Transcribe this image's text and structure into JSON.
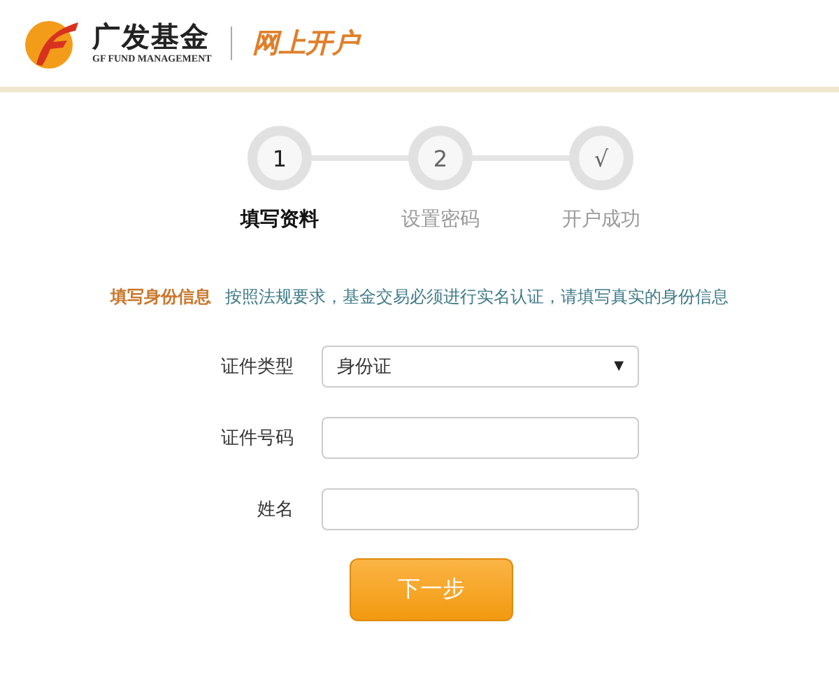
{
  "header": {
    "brand": "广发基金",
    "brand_sub": "GF FUND MANAGEMENT",
    "section": "网上开户"
  },
  "steps": [
    {
      "mark": "1",
      "label": "填写资料",
      "selected": true
    },
    {
      "mark": "2",
      "label": "设置密码",
      "selected": false
    },
    {
      "mark": "√",
      "label": "开户成功",
      "selected": false
    }
  ],
  "notice": {
    "title": "填写身份信息",
    "text": "按照法规要求，基金交易必须进行实名认证，请填写真实的身份信息"
  },
  "form": [
    {
      "kind": "select",
      "label": "证件类型",
      "value": "身份证",
      "arrow": "▼"
    },
    {
      "kind": "text",
      "label": "证件号码"
    },
    {
      "kind": "text",
      "label": "姓名"
    }
  ],
  "button": "下一步"
}
